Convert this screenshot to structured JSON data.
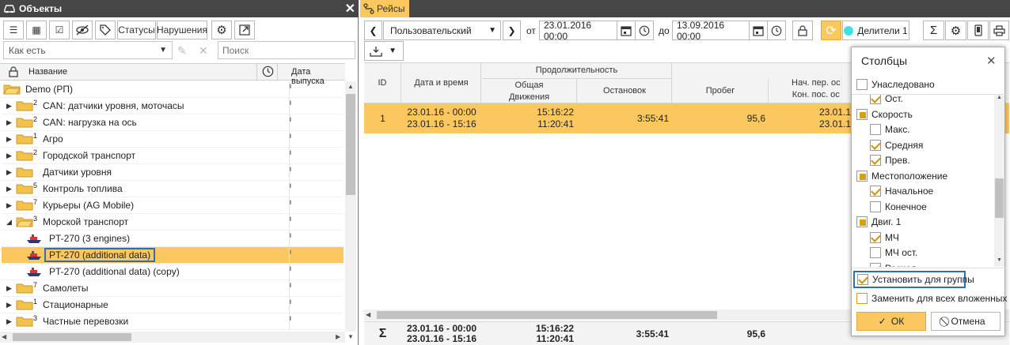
{
  "objects_panel": {
    "title": "Объекты",
    "toolbar": {
      "statuses_label": "Статусы",
      "violations_label": "Нарушения"
    },
    "filter": {
      "value": "Как есть",
      "search_placeholder": "Поиск"
    },
    "columns": {
      "name": "Название",
      "release_date": "Дата выпуска"
    },
    "tree": [
      {
        "name": "Demo (РП)",
        "count": "",
        "level": 0,
        "kind": "folder-open"
      },
      {
        "name": "CAN: датчики уровня, моточасы",
        "count": "2",
        "level": 1,
        "kind": "folder"
      },
      {
        "name": "CAN: нагрузка на ось",
        "count": "2",
        "level": 1,
        "kind": "folder"
      },
      {
        "name": "Агро",
        "count": "1",
        "level": 1,
        "kind": "folder"
      },
      {
        "name": "Городской транспорт",
        "count": "2",
        "level": 1,
        "kind": "folder"
      },
      {
        "name": "Датчики уровня",
        "count": "",
        "level": 1,
        "kind": "folder"
      },
      {
        "name": "Контроль топлива",
        "count": "5",
        "level": 1,
        "kind": "folder"
      },
      {
        "name": "Курьеры (AG Mobile)",
        "count": "7",
        "level": 1,
        "kind": "folder"
      },
      {
        "name": "Морской транспорт",
        "count": "3",
        "level": 1,
        "kind": "folder-open"
      },
      {
        "name": "PT-270 (3 engines)",
        "count": "",
        "level": 2,
        "kind": "ship"
      },
      {
        "name": "PT-270 (additional data)",
        "count": "",
        "level": 2,
        "kind": "ship"
      },
      {
        "name": "PT-270 (additional data) (copy)",
        "count": "",
        "level": 2,
        "kind": "ship"
      },
      {
        "name": "Самолеты",
        "count": "7",
        "level": 1,
        "kind": "folder"
      },
      {
        "name": "Стационарные",
        "count": "1",
        "level": 1,
        "kind": "folder"
      },
      {
        "name": "Частные перевозки",
        "count": "3",
        "level": 1,
        "kind": "folder"
      }
    ]
  },
  "trips_panel": {
    "tab_label": "Рейсы",
    "toolbar": {
      "period_mode": "Пользовательский",
      "from_label": "от",
      "from_value": "23.01.2016 00:00",
      "to_label": "до",
      "to_value": "13.09.2016 00:00",
      "dividers_label": "Делители 1"
    },
    "table": {
      "headers": {
        "id": "ID",
        "datetime": "Дата и время",
        "duration": "Продолжительность",
        "total_motion": "Общая\nДвижения",
        "stops": "Остановок",
        "mileage": "Пробег",
        "start_stop": "Нач. пер. ос\nКон. пос. ос"
      },
      "row": {
        "id": "1",
        "date_start": "23.01.16 - 00:00",
        "date_end": "23.01.16 - 15:16",
        "total": "15:16:22",
        "motion": "11:20:41",
        "stops": "3:55:41",
        "mileage": "95,6",
        "start_stop_1": "23.01.1",
        "start_stop_2": "23.01.1"
      },
      "summary": {
        "sigma": "Σ",
        "date_start": "23.01.16 - 00:00",
        "date_end": "23.01.16 - 15:16",
        "total": "15:16:22",
        "motion": "11:20:41",
        "stops": "3:55:41",
        "mileage": "95,6"
      }
    }
  },
  "columns_dialog": {
    "title": "Столбцы",
    "inherited_label": "Унаследовано",
    "items": [
      {
        "label": "Ост.",
        "level": 1,
        "state": "on"
      },
      {
        "label": "Скорость",
        "level": 0,
        "state": "part"
      },
      {
        "label": "Макс.",
        "level": 1,
        "state": "off"
      },
      {
        "label": "Средняя",
        "level": 1,
        "state": "on"
      },
      {
        "label": "Прев.",
        "level": 1,
        "state": "on"
      },
      {
        "label": "Местоположение",
        "level": 0,
        "state": "part"
      },
      {
        "label": "Начальное",
        "level": 1,
        "state": "on"
      },
      {
        "label": "Конечное",
        "level": 1,
        "state": "off"
      },
      {
        "label": "Двиг. 1",
        "level": 0,
        "state": "part"
      },
      {
        "label": "МЧ",
        "level": 1,
        "state": "on"
      },
      {
        "label": "МЧ ост.",
        "level": 1,
        "state": "off"
      },
      {
        "label": "Расход",
        "level": 1,
        "state": "on"
      }
    ],
    "set_for_group_label": "Установить для группы",
    "replace_all_label": "Заменить для всех вложенных",
    "ok_label": "ОК",
    "cancel_label": "Отмена"
  },
  "colors": {
    "accent": "#fbc860",
    "title_bar": "#464646",
    "highlight_border": "#2f6fb0"
  }
}
